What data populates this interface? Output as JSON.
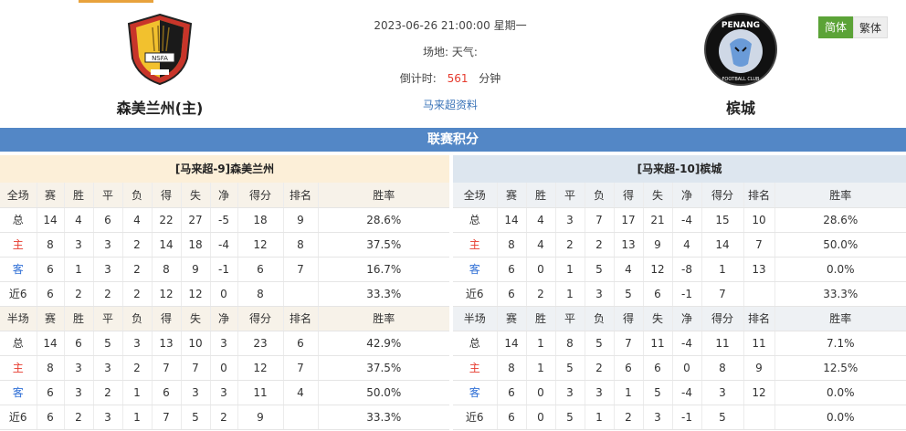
{
  "home": {
    "name": "森美兰州(主)",
    "logo_text": "NSFA"
  },
  "away": {
    "name": "槟城",
    "logo_text": "PENANG",
    "logo_sub": "FOOTBALL CLUB"
  },
  "match": {
    "datetime": "2023-06-26 21:00:00 星期一",
    "venue_label": "场地:",
    "weather_label": "天气:",
    "countdown_label": "倒计时:",
    "countdown_value": "561",
    "countdown_unit": "分钟",
    "league_link": "马来超资料"
  },
  "lang": {
    "simplified": "简体",
    "traditional": "繁体"
  },
  "banner": "联赛积分",
  "left": {
    "title": "[马来超-9]森美兰州",
    "full_header": [
      "全场",
      "赛",
      "胜",
      "平",
      "负",
      "得",
      "失",
      "净",
      "得分",
      "排名",
      "胜率"
    ],
    "full_rows": [
      [
        "总",
        "14",
        "4",
        "6",
        "4",
        "22",
        "27",
        "-5",
        "18",
        "9",
        "28.6%"
      ],
      [
        "主",
        "8",
        "3",
        "3",
        "2",
        "14",
        "18",
        "-4",
        "12",
        "8",
        "37.5%"
      ],
      [
        "客",
        "6",
        "1",
        "3",
        "2",
        "8",
        "9",
        "-1",
        "6",
        "7",
        "16.7%"
      ],
      [
        "近6",
        "6",
        "2",
        "2",
        "2",
        "12",
        "12",
        "0",
        "8",
        "",
        "33.3%"
      ]
    ],
    "half_header": [
      "半场",
      "赛",
      "胜",
      "平",
      "负",
      "得",
      "失",
      "净",
      "得分",
      "排名",
      "胜率"
    ],
    "half_rows": [
      [
        "总",
        "14",
        "6",
        "5",
        "3",
        "13",
        "10",
        "3",
        "23",
        "6",
        "42.9%"
      ],
      [
        "主",
        "8",
        "3",
        "3",
        "2",
        "7",
        "7",
        "0",
        "12",
        "7",
        "37.5%"
      ],
      [
        "客",
        "6",
        "3",
        "2",
        "1",
        "6",
        "3",
        "3",
        "11",
        "4",
        "50.0%"
      ],
      [
        "近6",
        "6",
        "2",
        "3",
        "1",
        "7",
        "5",
        "2",
        "9",
        "",
        "33.3%"
      ]
    ]
  },
  "right": {
    "title": "[马来超-10]槟城",
    "full_header": [
      "全场",
      "赛",
      "胜",
      "平",
      "负",
      "得",
      "失",
      "净",
      "得分",
      "排名",
      "胜率"
    ],
    "full_rows": [
      [
        "总",
        "14",
        "4",
        "3",
        "7",
        "17",
        "21",
        "-4",
        "15",
        "10",
        "28.6%"
      ],
      [
        "主",
        "8",
        "4",
        "2",
        "2",
        "13",
        "9",
        "4",
        "14",
        "7",
        "50.0%"
      ],
      [
        "客",
        "6",
        "0",
        "1",
        "5",
        "4",
        "12",
        "-8",
        "1",
        "13",
        "0.0%"
      ],
      [
        "近6",
        "6",
        "2",
        "1",
        "3",
        "5",
        "6",
        "-1",
        "7",
        "",
        "33.3%"
      ]
    ],
    "half_header": [
      "半场",
      "赛",
      "胜",
      "平",
      "负",
      "得",
      "失",
      "净",
      "得分",
      "排名",
      "胜率"
    ],
    "half_rows": [
      [
        "总",
        "14",
        "1",
        "8",
        "5",
        "7",
        "11",
        "-4",
        "11",
        "11",
        "7.1%"
      ],
      [
        "主",
        "8",
        "1",
        "5",
        "2",
        "6",
        "6",
        "0",
        "8",
        "9",
        "12.5%"
      ],
      [
        "客",
        "6",
        "0",
        "3",
        "3",
        "1",
        "5",
        "-4",
        "3",
        "12",
        "0.0%"
      ],
      [
        "近6",
        "6",
        "0",
        "5",
        "1",
        "2",
        "3",
        "-1",
        "5",
        "",
        "0.0%"
      ]
    ]
  }
}
